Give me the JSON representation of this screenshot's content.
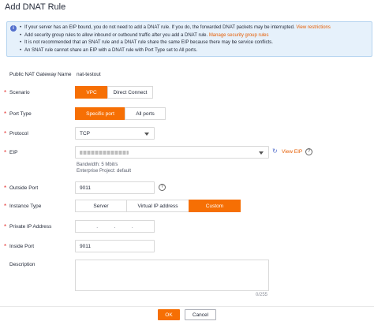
{
  "dialog": {
    "title": "Add DNAT Rule"
  },
  "notice": {
    "line1": "If your server has an EIP bound, you do not need to add a DNAT rule. If you do, the forwarded DNAT packets may be interrupted.",
    "line1_link": "View restrictions",
    "line2": "Add security group rules to allow inbound or outbound traffic after you add a DNAT rule.",
    "line2_link": "Manage security group rules",
    "line3": "It is not recommended that an SNAT rule and a DNAT rule share the same EIP because there may be service conflicts.",
    "line4": "An SNAT rule cannot share an EIP with a DNAT rule with Port Type set to All ports."
  },
  "form": {
    "gateway_label": "Public NAT Gateway Name",
    "gateway_value": "nat-testout",
    "scenario_label": "Scenario",
    "scenario_options": [
      "VPC",
      "Direct Connect"
    ],
    "scenario_selected": "VPC",
    "port_type_label": "Port Type",
    "port_type_options": [
      "Specific port",
      "All ports"
    ],
    "port_type_selected": "Specific port",
    "protocol_label": "Protocol",
    "protocol_value": "TCP",
    "eip_label": "EIP",
    "eip_view_link": "View EIP",
    "eip_bandwidth": "Bandwidth: 5 Mbit/s",
    "eip_enterprise": "Enterprise Project: default",
    "outside_port_label": "Outside Port",
    "outside_port_value": "9011",
    "instance_type_label": "Instance Type",
    "instance_type_options": [
      "Server",
      "Virtual IP address",
      "Custom"
    ],
    "instance_type_selected": "Custom",
    "private_ip_label": "Private IP Address",
    "inside_port_label": "Inside Port",
    "inside_port_value": "9011",
    "description_label": "Description",
    "description_counter": "0/255"
  },
  "footer": {
    "ok_label": "OK",
    "cancel_label": "Cancel"
  },
  "colors": {
    "accent": "#f66f04",
    "required": "#e5302e",
    "link": "#e55c00",
    "notice_bg": "#e6f1fb"
  }
}
